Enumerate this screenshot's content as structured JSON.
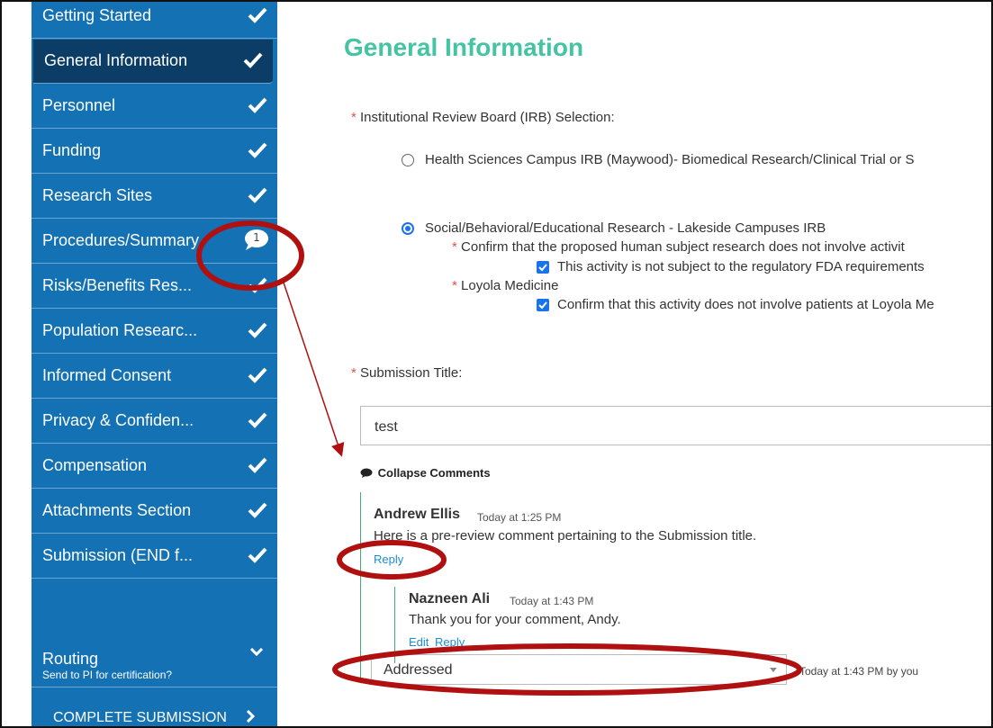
{
  "sidebar": {
    "items": [
      {
        "label": "Getting Started",
        "state": "check"
      },
      {
        "label": "General Information",
        "state": "check",
        "active": true
      },
      {
        "label": "Personnel",
        "state": "check"
      },
      {
        "label": "Funding",
        "state": "check"
      },
      {
        "label": "Research Sites",
        "state": "check"
      },
      {
        "label": "Procedures/Summary",
        "state": "comment",
        "comment_count": "1"
      },
      {
        "label": "Risks/Benefits Res...",
        "state": "check"
      },
      {
        "label": "Population Researc...",
        "state": "check"
      },
      {
        "label": "Informed Consent",
        "state": "check"
      },
      {
        "label": "Privacy & Confiden...",
        "state": "check"
      },
      {
        "label": "Compensation",
        "state": "check"
      },
      {
        "label": "Attachments Section",
        "state": "check"
      },
      {
        "label": "Submission (END f...",
        "state": "check"
      }
    ],
    "routing": {
      "title": "Routing",
      "subtitle": "Send to PI for certification?",
      "icon": "chevron-down-icon"
    },
    "complete": {
      "label": "COMPLETE SUBMISSION",
      "icon": "chevron-right-icon"
    }
  },
  "main": {
    "title": "General Information",
    "irb": {
      "label": "Institutional Review Board (IRB) Selection:",
      "options": [
        {
          "label": "Health Sciences Campus IRB (Maywood)- Biomedical Research/Clinical Trial or S",
          "selected": false
        },
        {
          "label": "Social/Behavioral/Educational Research - Lakeside Campuses IRB",
          "selected": true
        }
      ],
      "confirm_label": "Confirm that the proposed human subject research does not involve activit",
      "confirm_checkbox": "This activity is not subject to the regulatory FDA  requirements",
      "loyola_label": "Loyola Medicine",
      "loyola_checkbox": "Confirm that this activity does not involve patients at Loyola Me"
    },
    "submission_title": {
      "label": "Submission Title:",
      "value": "test"
    },
    "comments": {
      "toggle": "Collapse Comments",
      "thread": {
        "author": "Andrew Ellis",
        "time": "Today at 1:25 PM",
        "text": "Here is a pre-review comment pertaining to the Submission title.",
        "reply_label": "Reply",
        "replies": [
          {
            "author": "Nazneen Ali",
            "time": "Today at 1:43 PM",
            "text": "Thank you for your comment, Andy.",
            "edit_label": "Edit",
            "reply_label": "Reply"
          }
        ]
      },
      "status": {
        "value": "Addressed",
        "meta": "Today at 1:43 PM by you"
      }
    }
  },
  "colors": {
    "sidebar": "#1371b4",
    "sidebar_active": "#0c3d66",
    "title": "#45c4a4",
    "required": "#d9534f",
    "link": "#1a8fd3",
    "thread_line": "#3cb371",
    "annotation": "#b01010"
  }
}
